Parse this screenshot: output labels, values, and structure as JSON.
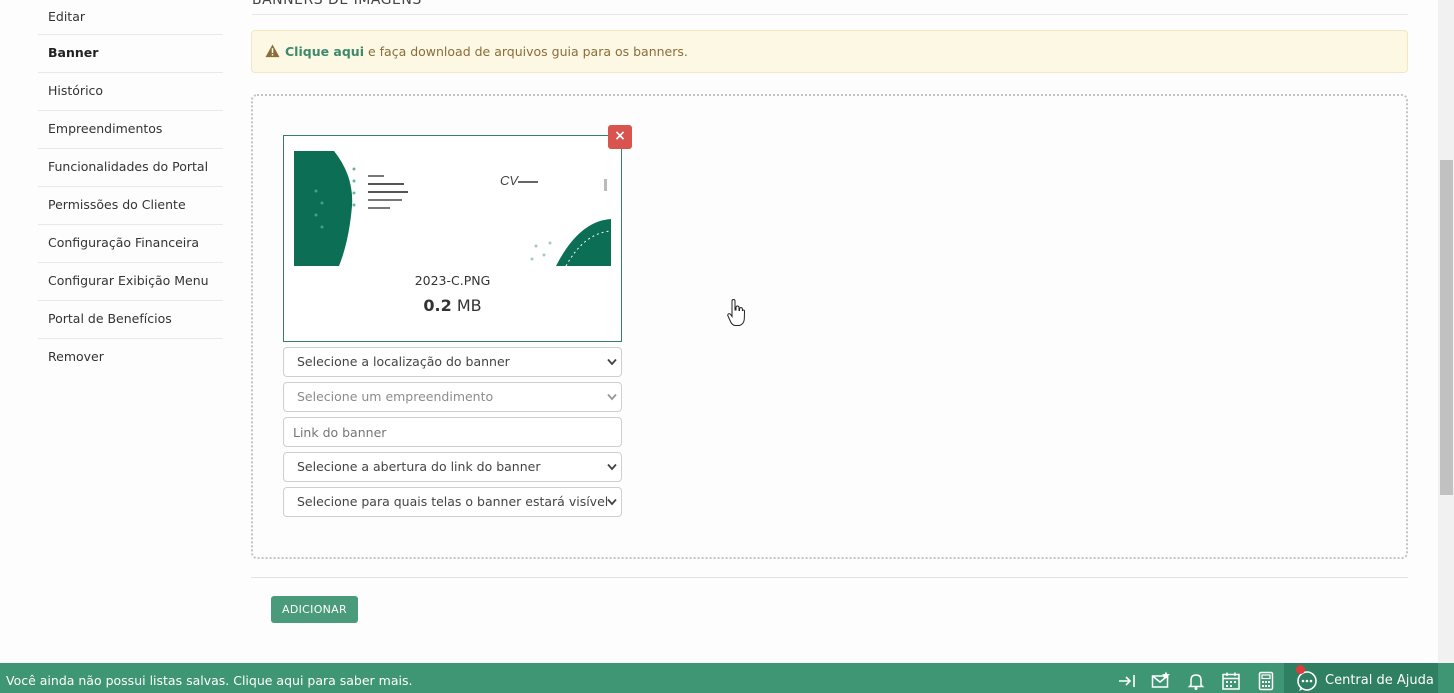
{
  "sidebar": {
    "items": [
      {
        "label": "Editar"
      },
      {
        "label": "Banner"
      },
      {
        "label": "Histórico"
      },
      {
        "label": "Empreendimentos"
      },
      {
        "label": "Funcionalidades do Portal"
      },
      {
        "label": "Permissões do Cliente"
      },
      {
        "label": "Configuração Financeira"
      },
      {
        "label": "Configurar Exibição Menu"
      },
      {
        "label": "Portal de Benefícios"
      },
      {
        "label": "Remover"
      }
    ],
    "active_item": "Banner"
  },
  "section": {
    "title": "BANNERS DE IMAGENS"
  },
  "alert": {
    "icon": "warning-icon",
    "link_text": "Clique aqui",
    "text": " e faça download de arquivos guia para os banners."
  },
  "upload": {
    "file_name": "2023-C.PNG",
    "file_size_value": "0.2",
    "file_size_unit": "MB",
    "remove_label": "×"
  },
  "form": {
    "location_select": "Selecione a localização do banner",
    "development_select": "Selecione um empreendimento",
    "link_placeholder": "Link do banner",
    "link_opening_select": "Selecione a abertura do link do banner",
    "screens_select": "Selecione para quais telas o banner estará visível"
  },
  "actions": {
    "add_label": "ADICIONAR"
  },
  "statusbar": {
    "message": "Você ainda não possui listas salvas. Clique aqui para saber mais.",
    "help_label": "Central de Ajuda",
    "icons": [
      "login-arrow-icon",
      "mail-star-icon",
      "bell-icon",
      "calendar-icon",
      "calculator-icon",
      "chat-help-icon"
    ]
  },
  "colors": {
    "brand_green": "#3f9674",
    "button_green": "#4a9a7c",
    "danger": "#d9534f",
    "alert_bg": "#fcf8e3",
    "alert_text": "#8a6d3b"
  }
}
